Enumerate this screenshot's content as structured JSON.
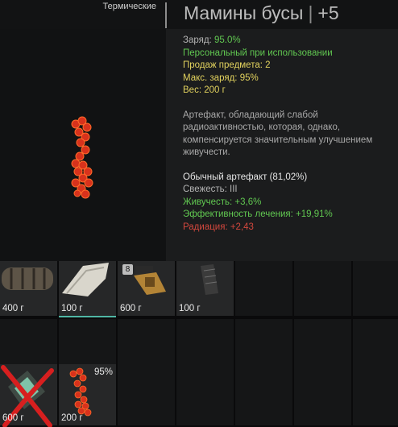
{
  "header": {
    "category": "Термические",
    "item_name": "Мамины бусы",
    "separator": "|",
    "upgrade": "+5"
  },
  "stats": {
    "charge_label": "Заряд:",
    "charge_value": "95.0%",
    "personal": "Персональный при использовании",
    "sell_label": "Продаж предмета:",
    "sell_value": "2",
    "max_charge_label": "Макс. заряд:",
    "max_charge_value": "95%",
    "weight_label": "Вес:",
    "weight_value": "200 г"
  },
  "description": "Артефакт, обладающий слабой радиоактивностью, которая, однако, компенсируется значительным улучшением живучести.",
  "properties": {
    "rarity": "Обычный артефакт (81,02%)",
    "freshness": "Свежесть: III",
    "vitality": "Живучесть: +3,6%",
    "healing": "Эффективность лечения: +19,91%",
    "radiation": "Радиация: +2,43"
  },
  "colors": {
    "stat_yellow": "#e2d25e",
    "bonus_green": "#61c851",
    "penalty_red": "#d2473d",
    "accent_teal": "#4fb7a5"
  },
  "inventory": {
    "slot_1": {
      "weight": "400 г",
      "icon": "rolled-bandage-icon"
    },
    "slot_2": {
      "weight": "100 г",
      "icon": "folded-cloth-icon"
    },
    "slot_3": {
      "weight": "600 г",
      "badge": "8",
      "icon": "medkit-bag-icon"
    },
    "slot_4": {
      "weight": "100 г",
      "icon": "dark-box-icon"
    },
    "slot_5": {
      "weight": "600 г",
      "icon": "container-icon",
      "marked": "red-cross-mark"
    },
    "slot_6": {
      "weight": "200 г",
      "charge": "95%",
      "icon": "artifact-beads-icon"
    }
  }
}
